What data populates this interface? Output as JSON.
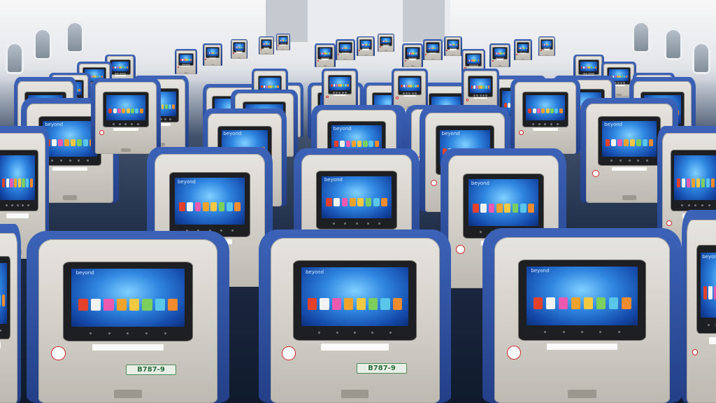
{
  "photo": {
    "seatback_screen": {
      "brand": "beyond"
    },
    "seat_label": "B787-9",
    "app_icon_colors": [
      "#e5412a",
      "#f2f2f2",
      "#ec5ab0",
      "#f0a32c",
      "#f5c842",
      "#7ccf5c",
      "#5ac7e8",
      "#f28a2e"
    ],
    "colors": {
      "seat_fabric": "#2b4b9a",
      "shell": "#d8d5cf",
      "screen_glow": "#2f86e0",
      "bezel": "#1d1f22"
    }
  }
}
